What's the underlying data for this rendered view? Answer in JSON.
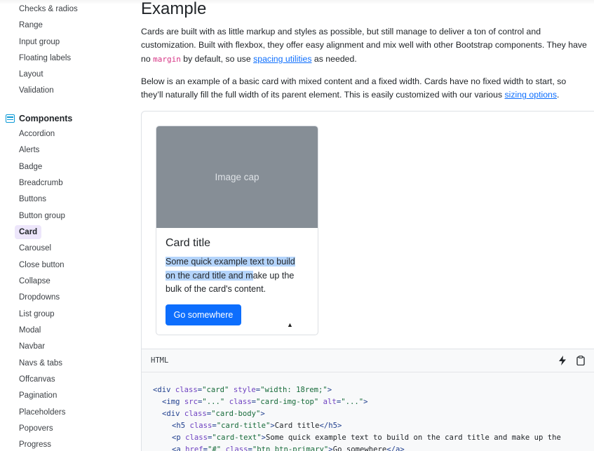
{
  "sidebar": {
    "forms_items": [
      "Checks & radios",
      "Range",
      "Input group",
      "Floating labels",
      "Layout",
      "Validation"
    ],
    "section_title": "Components",
    "section_icon": "components-icon",
    "items": [
      "Accordion",
      "Alerts",
      "Badge",
      "Breadcrumb",
      "Buttons",
      "Button group",
      "Card",
      "Carousel",
      "Close button",
      "Collapse",
      "Dropdowns",
      "List group",
      "Modal",
      "Navbar",
      "Navs & tabs",
      "Offcanvas",
      "Pagination",
      "Placeholders",
      "Popovers",
      "Progress"
    ],
    "active_item": "Card"
  },
  "main": {
    "heading": "Example",
    "p1": {
      "text1": "Cards are built with as little markup and styles as possible, but still manage to deliver a ton of control and customization. Built with flexbox, they offer easy alignment and mix well with other Bootstrap components. They have no ",
      "code": "margin",
      "text2": " by default, so use ",
      "link": "spacing utilities",
      "text3": " as needed."
    },
    "p2": {
      "line1": "Below is an example of a basic card with mixed content and a fixed width. Cards have no fixed width to start, so",
      "line2": "they’ll naturally fill the full width of its parent element. This is easily customized with our various ",
      "link": "sizing options",
      "end": "."
    }
  },
  "card": {
    "image_cap": "Image cap",
    "title": "Card title",
    "text_highlighted_1": "Some quick example text to build",
    "text_highlighted_2": "on the card title and m",
    "text_rest_2": "ake up the",
    "text_line3": "bulk of the card's content.",
    "button": "Go somewhere"
  },
  "code": {
    "lang": "HTML",
    "tools": [
      "lightning-icon",
      "clipboard-icon"
    ],
    "lines": [
      [
        [
          "tg",
          "<div "
        ],
        [
          "at",
          "class"
        ],
        [
          "tg",
          "="
        ],
        [
          "st",
          "\"card\""
        ],
        [
          "tg",
          " "
        ],
        [
          "at",
          "style"
        ],
        [
          "tg",
          "="
        ],
        [
          "st",
          "\"width: 18rem;\""
        ],
        [
          "tg",
          ">"
        ]
      ],
      [
        [
          "tg",
          "<img "
        ],
        [
          "at",
          "src"
        ],
        [
          "tg",
          "="
        ],
        [
          "st",
          "\"...\""
        ],
        [
          "tg",
          " "
        ],
        [
          "at",
          "class"
        ],
        [
          "tg",
          "="
        ],
        [
          "st",
          "\"card-img-top\""
        ],
        [
          "tg",
          " "
        ],
        [
          "at",
          "alt"
        ],
        [
          "tg",
          "="
        ],
        [
          "st",
          "\"...\""
        ],
        [
          "tg",
          ">"
        ]
      ],
      [
        [
          "tg",
          "<div "
        ],
        [
          "at",
          "class"
        ],
        [
          "tg",
          "="
        ],
        [
          "st",
          "\"card-body\""
        ],
        [
          "tg",
          ">"
        ]
      ],
      [
        [
          "tg",
          "<h5 "
        ],
        [
          "at",
          "class"
        ],
        [
          "tg",
          "="
        ],
        [
          "st",
          "\"card-title\""
        ],
        [
          "tg",
          ">"
        ],
        [
          "tx",
          "Card title"
        ],
        [
          "tg",
          "</h5>"
        ]
      ],
      [
        [
          "tg",
          "<p "
        ],
        [
          "at",
          "class"
        ],
        [
          "tg",
          "="
        ],
        [
          "st",
          "\"card-text\""
        ],
        [
          "tg",
          ">"
        ],
        [
          "tx",
          "Some quick example text to build on the card title and make up the"
        ]
      ],
      [
        [
          "tg",
          "<a "
        ],
        [
          "at",
          "href"
        ],
        [
          "tg",
          "="
        ],
        [
          "st",
          "\"#\""
        ],
        [
          "tg",
          " "
        ],
        [
          "at",
          "class"
        ],
        [
          "tg",
          "="
        ],
        [
          "st",
          "\"btn btn-primary\""
        ],
        [
          "tg",
          ">"
        ],
        [
          "tx",
          "Go somewhere"
        ],
        [
          "tg",
          "</a>"
        ]
      ]
    ]
  },
  "colors": {
    "primary": "#0d6efd",
    "active_bg": "#ede6fb",
    "image_cap_bg": "#868e96",
    "selection": "#b4d4fb"
  }
}
